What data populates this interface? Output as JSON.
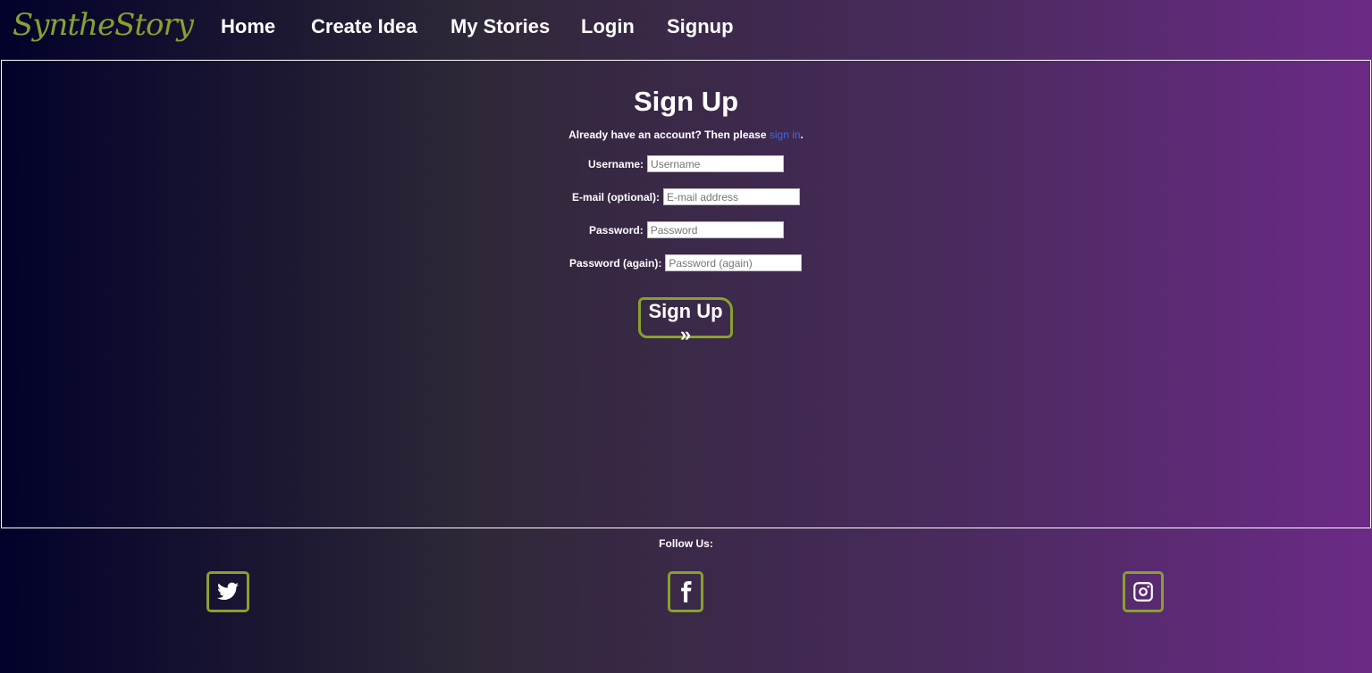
{
  "brand": "SyntheStory",
  "nav": {
    "home": "Home",
    "create_idea": "Create Idea",
    "my_stories": "My Stories",
    "login": "Login",
    "signup": "Signup"
  },
  "form": {
    "title": "Sign Up",
    "already_text": "Already have an account? Then please ",
    "signin_link": "sign in",
    "already_end": ".",
    "username_label": "Username:",
    "username_placeholder": "Username",
    "email_label": "E-mail (optional):",
    "email_placeholder": "E-mail address",
    "password_label": "Password:",
    "password_placeholder": "Password",
    "password2_label": "Password (again):",
    "password2_placeholder": "Password (again)",
    "submit_label": "Sign Up »"
  },
  "footer": {
    "follow_label": "Follow Us:",
    "icons": [
      "twitter-icon",
      "facebook-icon",
      "instagram-icon"
    ]
  },
  "colors": {
    "accent": "#88a12d",
    "link": "#2e6fe8"
  }
}
